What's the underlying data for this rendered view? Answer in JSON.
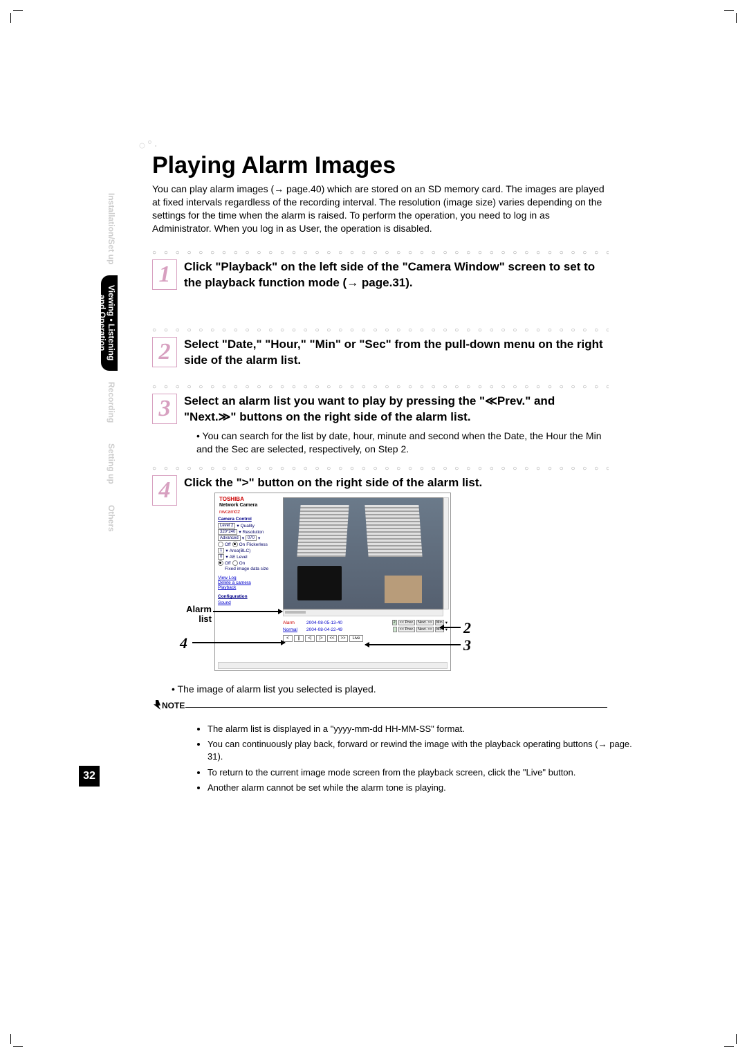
{
  "page_number": "32",
  "title": "Playing Alarm Images",
  "intro": "You can play alarm images (→ page.40) which are stored on an SD memory card. The images are played at fixed intervals regardless of the recording interval. The resolution (image size) varies depending on the settings for the time when the alarm is raised. To perform the operation, you need to log in as Administrator. When you log in as User, the operation is disabled.",
  "sidebar": {
    "tabs": [
      {
        "label": "Installation/Set up",
        "active": false
      },
      {
        "label": "Viewing • Listening\nand Operation",
        "active": true
      },
      {
        "label": "Recording",
        "active": false
      },
      {
        "label": "Setting up",
        "active": false
      },
      {
        "label": "Others",
        "active": false
      }
    ]
  },
  "steps": [
    {
      "num": "1",
      "text": "Click \"Playback\" on the left side of the \"Camera Window\" screen to set to the playback function mode (→ page.31).",
      "sub": ""
    },
    {
      "num": "2",
      "text": "Select \"Date,\" \"Hour,\" \"Min\" or \"Sec\" from the pull-down menu on the right side of the alarm list.",
      "sub": ""
    },
    {
      "num": "3",
      "text": "Select an alarm list you want to play by pressing the \"≪Prev.\" and \"Next.≫\" buttons on the right side of the alarm list.",
      "sub": "• You can search for the list by date, hour, minute and second when the Date, the Hour the Min and the Sec are selected, respectively, on Step 2."
    },
    {
      "num": "4",
      "text": "Click the \">\" button on the right side of the alarm list.",
      "sub": ""
    }
  ],
  "screenshot": {
    "brand": "TOSHIBA",
    "brand_sub": "Network Camera",
    "camera_name": "nwcam02",
    "left_panel": {
      "title": "Camera Control",
      "quality_value": "Level 2",
      "quality_label": "Quality",
      "res_value": "320*240",
      "res_label": "Resolution",
      "adv_label": "Advanced",
      "pct_value": "070",
      "flickerless_label": "Flickerless",
      "off_label": "Off",
      "on_label": "On",
      "area_label": "Area(BLC)",
      "area_value": "1",
      "ae_label": "AE Level",
      "ae_value": "0",
      "fixed_label": "Fixed image data size",
      "links": [
        "View Log",
        "Delete a camera",
        "Playback"
      ],
      "config_title": "Configuration",
      "config_link": "Sound"
    },
    "alarm_list": {
      "row1_type": "Alarm",
      "row1_date": "2004-08-05-13-40",
      "row1_count": "2",
      "row1_prev": "<< Prev.",
      "row1_next": "Next. >>",
      "row1_unit": "Min",
      "row2_type": "Normal",
      "row2_date": "2004-08-04-22-49",
      "row2_prev": "<< Prev.",
      "row2_next": "Next. >>",
      "row2_unit": "Min",
      "play_buttons": [
        "<",
        "||",
        "<|",
        "|>",
        "<<",
        ">>",
        "Live"
      ]
    }
  },
  "callouts": {
    "alarm_list": "Alarm list",
    "c2": "2",
    "c3": "3",
    "c4": "4"
  },
  "post_image": "• The image of alarm list you selected is played.",
  "note_title": "NOTE",
  "notes": [
    "The alarm list is displayed in a \"yyyy-mm-dd HH-MM-SS\" format.",
    "You can continuously play back, forward or rewind the image with the playback operating buttons (→ page. 31).",
    "To return to the current image mode screen from the playback screen, click the \"Live\" button.",
    "Another alarm cannot be set while the alarm tone is playing."
  ]
}
